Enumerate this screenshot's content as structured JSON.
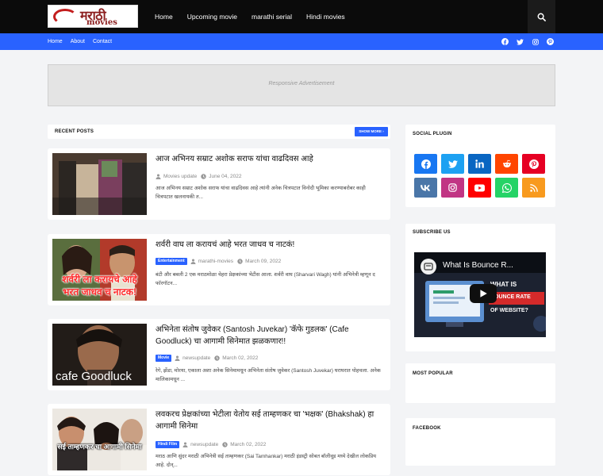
{
  "header": {
    "logo": {
      "script": "मराठी",
      "word": "movies"
    },
    "nav": [
      "Home",
      "Upcoming movie",
      "marathi serial",
      "Hindi movies"
    ],
    "search_icon": "search-icon"
  },
  "subnav": {
    "links": [
      "Home",
      "About",
      "Contact"
    ],
    "social_icons": [
      "facebook-icon",
      "twitter-icon",
      "instagram-icon",
      "pinterest-icon"
    ]
  },
  "ad": {
    "label": "Responsive Advertisement"
  },
  "recent": {
    "title": "RECENT POSTS",
    "show_more": "SHOW MORE ›",
    "posts": [
      {
        "title": "आज अभिनय सम्राट अशोक सराफ यांचा वाढदिवस आहे",
        "tag": "",
        "author": "Movies update",
        "date": "June 04, 2022",
        "snippet": "आज अभिनय सम्राट अशोक सराफ यांचा वाढदिवस आहे त्यांनी अनेक चित्रपटात विनोदी भूमिका करण्याबरोबर काही चित्रपटात खलनायकी त..."
      },
      {
        "title": "शर्वरी वाघ ला करायचं आहे भरत जाधव च नाटकं!",
        "tag": "Entertainment",
        "author": "marathi-movies",
        "date": "March 09, 2022",
        "snippet": "बंटी और बबली 2 एक मराठमोळा चेहरा प्रेक्षकांच्या भेटीस आला. शर्वरी वाघ (Sharvari Wagh) यांनी अभिनेत्री म्हणून द फॉरगॉटन...",
        "thumb_text": [
          "शर्वरी ला करायचे आहे",
          "भरत जाधव च नाटक!"
        ]
      },
      {
        "title": "अभिनेता संतोष जुवेकर (Santosh Juvekar) 'कॅफे गुडलक' (Cafe Goodluck) चा आगामी सिनेमात झळकणार!!",
        "tag": "Movie",
        "author": "newsupdate",
        "date": "March 02, 2022",
        "snippet": "रेगे, झेंडा, मोरया, एकाला अशा अनेक सिनेमामधून अभिनेता संतोष जुवेकर (Santosh Juvekar) घराघरात पोहचला. अनेक मालिकामधून ...",
        "thumb_text": [
          "cafe Goodluck"
        ]
      },
      {
        "title": "लवकरच प्रेक्षकांच्या भेटीला येतोय सई ताम्हणकर चा 'भक्षक' (Bhakshak) हा आगामी सिनेमा",
        "tag": "Hindi Film",
        "author": "newsupdate",
        "date": "March 02, 2022",
        "snippet": "मराठ आणि सुंदर मराठी अभिनेत्री सई ताम्हणकर (Sai Tamhankar) मराठी इंडस्ट्री सोबत बॉलीवूड मध्ये देखील लोकप्रिय आहे. दोन्...",
        "thumb_text": [
          "सई ताम्हणकर चा आगामी सिनेमा"
        ]
      }
    ]
  },
  "sidebar": {
    "social_title": "SOCIAL PLUGIN",
    "social_buttons": [
      {
        "icon": "facebook-icon",
        "color": "#1877f2"
      },
      {
        "icon": "twitter-icon",
        "color": "#1da1f2"
      },
      {
        "icon": "linkedin-icon",
        "color": "#0a66c2"
      },
      {
        "icon": "reddit-icon",
        "color": "#ff4500"
      },
      {
        "icon": "pinterest-icon",
        "color": "#e60023"
      },
      {
        "icon": "vk-icon",
        "color": "#4a76a8"
      },
      {
        "icon": "instagram-icon",
        "color": "#c13584"
      },
      {
        "icon": "youtube-icon",
        "color": "#ff0000"
      },
      {
        "icon": "whatsapp-icon",
        "color": "#25d366"
      },
      {
        "icon": "rss-icon",
        "color": "#f89a1e"
      }
    ],
    "subscribe_title": "SUBSCRIBE US",
    "video": {
      "title": "What Is Bounce R...",
      "overlay": [
        "WHAT IS",
        "BOUNCE RATE",
        "OF WEBSITE?"
      ]
    },
    "popular_title": "MOST POPULAR",
    "facebook_title": "FACEBOOK"
  },
  "colors": {
    "accent": "#2962ff",
    "header_bg": "#0b0b0b",
    "page_bg": "#f3f4f6"
  }
}
